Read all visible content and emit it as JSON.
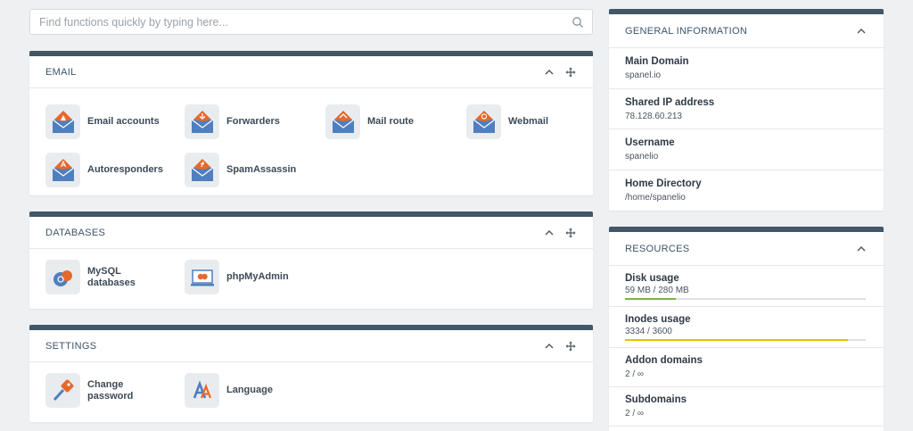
{
  "search": {
    "placeholder": "Find functions quickly by typing here...",
    "value": ""
  },
  "email": {
    "title": "EMAIL",
    "items": [
      {
        "label": "Email accounts"
      },
      {
        "label": "Forwarders"
      },
      {
        "label": "Mail route"
      },
      {
        "label": "Webmail"
      },
      {
        "label": "Autoresponders"
      },
      {
        "label": "SpamAssassin"
      }
    ]
  },
  "databases": {
    "title": "DATABASES",
    "items": [
      {
        "label": "MySQL\ndatabases"
      },
      {
        "label": "phpMyAdmin"
      }
    ]
  },
  "settings": {
    "title": "SETTINGS",
    "items": [
      {
        "label": "Change\npassword"
      },
      {
        "label": "Language"
      }
    ]
  },
  "general": {
    "title": "GENERAL INFORMATION",
    "rows": [
      {
        "label": "Main Domain",
        "value": "spanel.io"
      },
      {
        "label": "Shared IP address",
        "value": "78.128.60.213"
      },
      {
        "label": "Username",
        "value": "spanelio"
      },
      {
        "label": "Home Directory",
        "value": "/home/spanelio"
      }
    ]
  },
  "resources": {
    "title": "RESOURCES",
    "rows": [
      {
        "label": "Disk usage",
        "value": "59 MB / 280 MB",
        "fraction": 0.21,
        "color": "#7cb342"
      },
      {
        "label": "Inodes usage",
        "value": "3334 / 3600",
        "fraction": 0.926,
        "color": "#e5c300"
      },
      {
        "label": "Addon domains",
        "value": "2 / ∞"
      },
      {
        "label": "Subdomains",
        "value": "2 / ∞"
      }
    ]
  },
  "colors": {
    "header_bar": "#425768",
    "icon_orange": "#e8682a",
    "icon_blue": "#4f7fbf"
  }
}
